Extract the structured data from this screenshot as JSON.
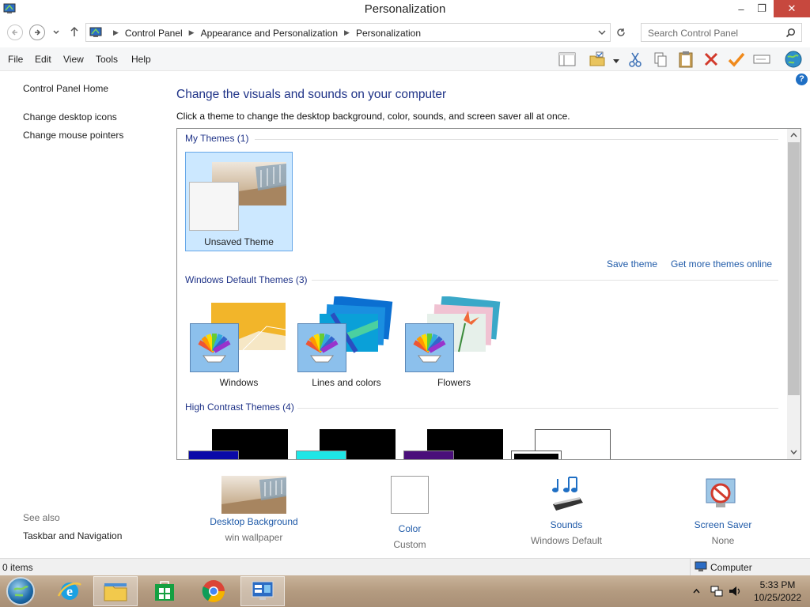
{
  "window": {
    "title": "Personalization",
    "controls": {
      "minimize": "–",
      "restore": "❐",
      "close": "✕"
    }
  },
  "address": {
    "crumbs": [
      "Control Panel",
      "Appearance and Personalization",
      "Personalization"
    ],
    "search_placeholder": "Search Control Panel"
  },
  "menu": [
    "File",
    "Edit",
    "View",
    "Tools",
    "Help"
  ],
  "left_panel": {
    "home": "Control Panel Home",
    "links": [
      "Change desktop icons",
      "Change mouse pointers"
    ],
    "see_also_title": "See also",
    "see_also_links": [
      "Taskbar and Navigation"
    ]
  },
  "main": {
    "heading": "Change the visuals and sounds on your computer",
    "subheading": "Click a theme to change the desktop background, color, sounds, and screen saver all at once.",
    "groups": {
      "my_themes": {
        "title": "My Themes (1)",
        "themes": [
          "Unsaved Theme"
        ]
      },
      "default_themes": {
        "title": "Windows Default Themes (3)",
        "themes": [
          "Windows",
          "Lines and colors",
          "Flowers"
        ]
      },
      "high_contrast": {
        "title": "High Contrast Themes (4)"
      }
    },
    "save_theme": "Save theme",
    "get_more": "Get more themes online"
  },
  "settings": [
    {
      "label": "Desktop Background",
      "value": "win wallpaper"
    },
    {
      "label": "Color",
      "value": "Custom"
    },
    {
      "label": "Sounds",
      "value": "Windows Default"
    },
    {
      "label": "Screen Saver",
      "value": "None"
    }
  ],
  "status": {
    "items": "0 items",
    "location": "Computer"
  },
  "clock": {
    "time": "5:33 PM",
    "date": "10/25/2022"
  },
  "colors": {
    "link": "#1f5aa8",
    "heading": "#1e3287",
    "selected": "#cce8ff",
    "close": "#c7483e"
  }
}
